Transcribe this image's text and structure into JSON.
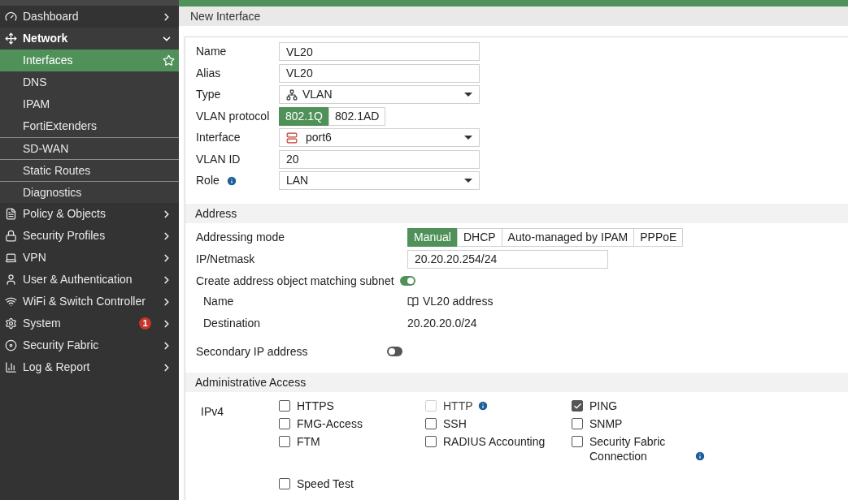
{
  "sidebar": {
    "items": [
      {
        "label": "Dashboard",
        "expanded": false
      },
      {
        "label": "Network",
        "expanded": true,
        "children": [
          {
            "label": "Interfaces",
            "selected": true,
            "divider_above": false
          },
          {
            "label": "DNS",
            "selected": false,
            "divider_above": false
          },
          {
            "label": "IPAM",
            "selected": false,
            "divider_above": false
          },
          {
            "label": "FortiExtenders",
            "selected": false,
            "divider_above": false
          },
          {
            "label": "SD-WAN",
            "selected": false,
            "divider_above": true
          },
          {
            "label": "Static Routes",
            "selected": false,
            "divider_above": true
          },
          {
            "label": "Diagnostics",
            "selected": false,
            "divider_above": true
          }
        ]
      },
      {
        "label": "Policy & Objects",
        "expanded": false
      },
      {
        "label": "Security Profiles",
        "expanded": false
      },
      {
        "label": "VPN",
        "expanded": false
      },
      {
        "label": "User & Authentication",
        "expanded": false
      },
      {
        "label": "WiFi & Switch Controller",
        "expanded": false
      },
      {
        "label": "System",
        "expanded": false,
        "badge": "1"
      },
      {
        "label": "Security Fabric",
        "expanded": false
      },
      {
        "label": "Log & Report",
        "expanded": false
      }
    ]
  },
  "page_title": "New Interface",
  "general": [
    {
      "kind": "input",
      "label": "Name",
      "value": "VL20"
    },
    {
      "kind": "input",
      "label": "Alias",
      "value": "VL20"
    },
    {
      "kind": "select",
      "label": "Type",
      "value": "VLAN"
    },
    {
      "kind": "segmented",
      "label": "VLAN protocol",
      "options": [
        {
          "label": "802.1Q",
          "selected": true
        },
        {
          "label": "802.1AD",
          "selected": false
        }
      ]
    },
    {
      "kind": "select",
      "label": "Interface",
      "value": "port6"
    },
    {
      "kind": "input",
      "label": "VLAN ID",
      "value": "20"
    },
    {
      "kind": "select",
      "label": "Role",
      "value": "LAN",
      "info": true
    }
  ],
  "address": {
    "title": "Address",
    "rows": [
      {
        "kind": "segmented",
        "label": "Addressing mode",
        "options": [
          {
            "label": "Manual",
            "selected": true
          },
          {
            "label": "DHCP",
            "selected": false
          },
          {
            "label": "Auto-managed by IPAM",
            "selected": false
          },
          {
            "label": "PPPoE",
            "selected": false
          }
        ]
      },
      {
        "kind": "input",
        "label": "IP/Netmask",
        "value": "20.20.20.254/24"
      },
      {
        "kind": "toggle",
        "label": "Create address object matching subnet",
        "on": true,
        "children": [
          {
            "label": "Name",
            "value": "VL20 address"
          },
          {
            "label": "Destination",
            "value": "20.20.20.0/24"
          }
        ]
      },
      {
        "kind": "toggle",
        "label": "Secondary IP address",
        "on": false
      }
    ]
  },
  "admin_access": {
    "title": "Administrative Access",
    "label": "IPv4",
    "options": [
      {
        "label": "HTTPS",
        "checked": false,
        "disabled": false
      },
      {
        "label": "HTTP",
        "checked": false,
        "disabled": true,
        "info": true
      },
      {
        "label": "PING",
        "checked": true,
        "disabled": false
      },
      {
        "label": "FMG-Access",
        "checked": false,
        "disabled": false
      },
      {
        "label": "SSH",
        "checked": false,
        "disabled": false
      },
      {
        "label": "SNMP",
        "checked": false,
        "disabled": false
      },
      {
        "label": "FTM",
        "checked": false,
        "disabled": false
      },
      {
        "label": "RADIUS Accounting",
        "checked": false,
        "disabled": false
      },
      {
        "label": "Security Fabric Connection",
        "checked": false,
        "disabled": false,
        "info": true
      },
      {
        "label": "Speed Test",
        "checked": false,
        "disabled": false
      }
    ]
  }
}
